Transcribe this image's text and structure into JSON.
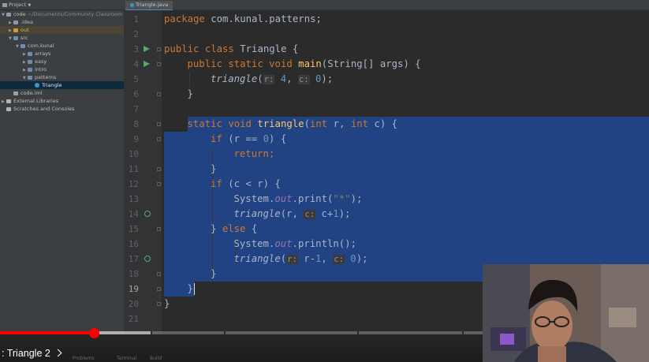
{
  "sidebar": {
    "header": "Project",
    "items": [
      {
        "label": "code",
        "path": "~/Documents/Community Classroom",
        "icon": "folder-icon",
        "arrow": "open",
        "depth": 0
      },
      {
        "label": ".idea",
        "icon": "folder-icon",
        "arrow": "closed",
        "depth": 1
      },
      {
        "label": "out",
        "icon": "excluded-folder-icon",
        "arrow": "closed",
        "depth": 1,
        "excluded": true
      },
      {
        "label": "src",
        "icon": "source-folder-icon",
        "arrow": "open",
        "depth": 1
      },
      {
        "label": "com.kunal",
        "icon": "package-icon",
        "arrow": "open",
        "depth": 2
      },
      {
        "label": "arrays",
        "icon": "package-icon",
        "arrow": "closed",
        "depth": 3
      },
      {
        "label": "easy",
        "icon": "package-icon",
        "arrow": "closed",
        "depth": 3
      },
      {
        "label": "intro",
        "icon": "package-icon",
        "arrow": "closed",
        "depth": 3
      },
      {
        "label": "patterns",
        "icon": "package-icon",
        "arrow": "open",
        "depth": 3
      },
      {
        "label": "Triangle",
        "icon": "java-class-icon",
        "arrow": "none",
        "depth": 4,
        "selected": true
      },
      {
        "label": "code.iml",
        "icon": "iml-file-icon",
        "arrow": "none",
        "depth": 1
      },
      {
        "label": "External Libraries",
        "icon": "library-icon",
        "arrow": "closed",
        "depth": 0
      },
      {
        "label": "Scratches and Consoles",
        "icon": "scratches-icon",
        "arrow": "none",
        "depth": 0
      }
    ]
  },
  "editor": {
    "tab_label": "Triangle.java",
    "current_line": 19,
    "selection": {
      "from_line": 8,
      "to_line": 19
    }
  },
  "code_lines": [
    {
      "n": 1,
      "indent": 0,
      "tokens": [
        {
          "t": "package ",
          "c": "kw"
        },
        {
          "t": "com.kunal.patterns;"
        }
      ]
    },
    {
      "n": 2,
      "indent": 0,
      "tokens": []
    },
    {
      "n": 3,
      "indent": 0,
      "run": true,
      "tokens": [
        {
          "t": "public class ",
          "c": "kw"
        },
        {
          "t": "Triangle {"
        }
      ]
    },
    {
      "n": 4,
      "indent": 1,
      "run": true,
      "tokens": [
        {
          "t": "public static void ",
          "c": "kw"
        },
        {
          "t": "main",
          "c": "fn"
        },
        {
          "t": "(String[] args) {"
        }
      ]
    },
    {
      "n": 5,
      "indent": 2,
      "tokens": [
        {
          "t": "triangle",
          "c": "it"
        },
        {
          "t": "("
        },
        {
          "t": "r:",
          "c": "hint"
        },
        {
          "t": " "
        },
        {
          "t": "4",
          "c": "num"
        },
        {
          "t": ", "
        },
        {
          "t": "c:",
          "c": "hint"
        },
        {
          "t": " "
        },
        {
          "t": "0",
          "c": "num"
        },
        {
          "t": ");"
        }
      ]
    },
    {
      "n": 6,
      "indent": 1,
      "tokens": [
        {
          "t": "}"
        }
      ]
    },
    {
      "n": 7,
      "indent": 0,
      "tokens": []
    },
    {
      "n": 8,
      "indent": 1,
      "tokens": [
        {
          "t": "static void ",
          "c": "kw"
        },
        {
          "t": "triangle",
          "c": "fn"
        },
        {
          "t": "("
        },
        {
          "t": "int ",
          "c": "kw"
        },
        {
          "t": "r, "
        },
        {
          "t": "int ",
          "c": "kw"
        },
        {
          "t": "c) {"
        }
      ]
    },
    {
      "n": 9,
      "indent": 2,
      "tokens": [
        {
          "t": "if ",
          "c": "kw"
        },
        {
          "t": "(r == "
        },
        {
          "t": "0",
          "c": "num"
        },
        {
          "t": ") {"
        }
      ]
    },
    {
      "n": 10,
      "indent": 3,
      "tokens": [
        {
          "t": "return;",
          "c": "kw"
        }
      ]
    },
    {
      "n": 11,
      "indent": 2,
      "tokens": [
        {
          "t": "}"
        }
      ]
    },
    {
      "n": 12,
      "indent": 2,
      "tokens": [
        {
          "t": "if ",
          "c": "kw"
        },
        {
          "t": "(c < r) {"
        }
      ]
    },
    {
      "n": 13,
      "indent": 3,
      "tokens": [
        {
          "t": "System."
        },
        {
          "t": "out",
          "c": "fld"
        },
        {
          "t": ".print("
        },
        {
          "t": "\"*\"",
          "c": "str"
        },
        {
          "t": ");"
        }
      ]
    },
    {
      "n": 14,
      "indent": 3,
      "recursion": true,
      "tokens": [
        {
          "t": "triangle",
          "c": "it"
        },
        {
          "t": "(r, "
        },
        {
          "t": "c:",
          "c": "hint"
        },
        {
          "t": " c+"
        },
        {
          "t": "1",
          "c": "num"
        },
        {
          "t": ");"
        }
      ]
    },
    {
      "n": 15,
      "indent": 2,
      "tokens": [
        {
          "t": "} "
        },
        {
          "t": "else ",
          "c": "kw"
        },
        {
          "t": "{"
        }
      ]
    },
    {
      "n": 16,
      "indent": 3,
      "tokens": [
        {
          "t": "System."
        },
        {
          "t": "out",
          "c": "fld"
        },
        {
          "t": ".println();"
        }
      ]
    },
    {
      "n": 17,
      "indent": 3,
      "recursion": true,
      "tokens": [
        {
          "t": "triangle",
          "c": "it"
        },
        {
          "t": "("
        },
        {
          "t": "r:",
          "c": "hint"
        },
        {
          "t": " r-"
        },
        {
          "t": "1",
          "c": "num"
        },
        {
          "t": ", "
        },
        {
          "t": "c:",
          "c": "hint"
        },
        {
          "t": " "
        },
        {
          "t": "0",
          "c": "num"
        },
        {
          "t": ");"
        }
      ]
    },
    {
      "n": 18,
      "indent": 2,
      "tokens": [
        {
          "t": "}"
        }
      ]
    },
    {
      "n": 19,
      "indent": 1,
      "tokens": [
        {
          "t": "}"
        }
      ]
    },
    {
      "n": 20,
      "indent": 0,
      "tokens": [
        {
          "t": "}"
        }
      ]
    },
    {
      "n": 21,
      "indent": 0,
      "tokens": []
    }
  ],
  "video": {
    "chapter_label": ": Triangle 2",
    "played_fraction": 0.145,
    "buffered_fraction": 0.232,
    "chapter_gaps": [
      0.232,
      0.345,
      0.55,
      0.712
    ],
    "colors": {
      "played": "#ff0000",
      "selection": "#214283",
      "keyword": "#cc7832"
    }
  },
  "statusbar": {
    "items": [
      "Problems",
      "Terminal",
      "Build"
    ]
  }
}
